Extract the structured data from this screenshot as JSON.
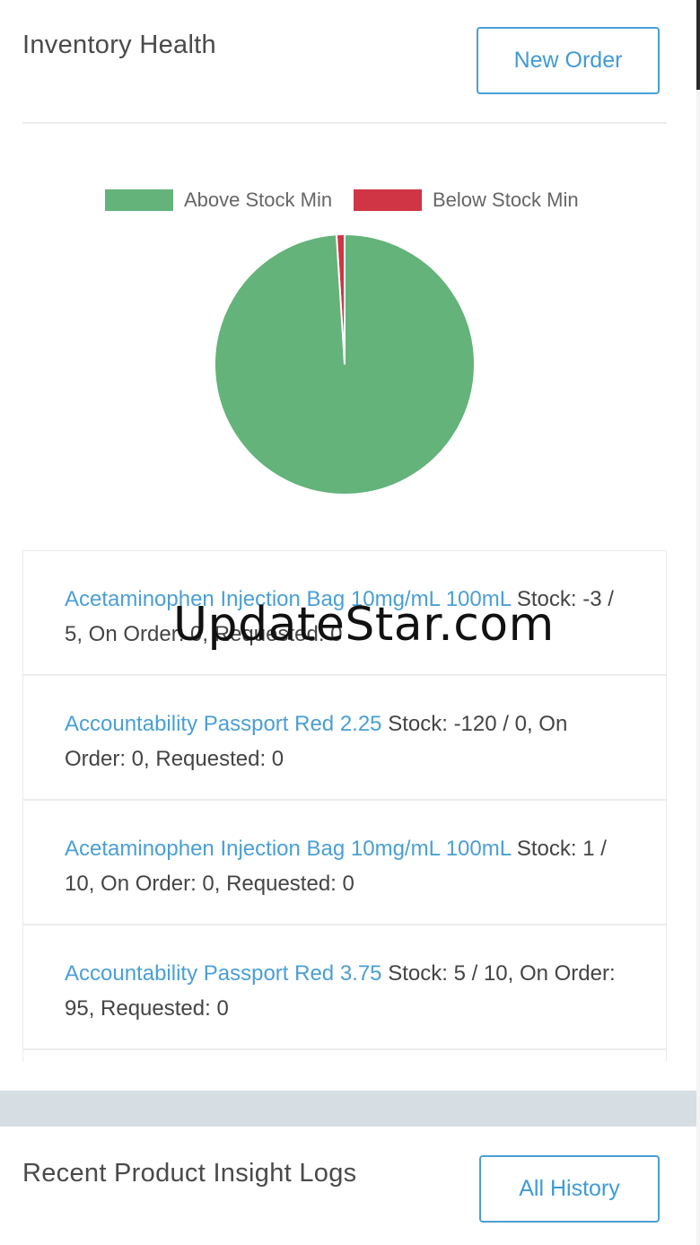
{
  "inventory": {
    "title": "Inventory Health",
    "new_order_label": "New Order"
  },
  "legend": [
    {
      "label": "Above Stock Min",
      "color": "#63b37a"
    },
    {
      "label": "Below Stock Min",
      "color": "#cf3544"
    }
  ],
  "chart_data": {
    "type": "pie",
    "slices": [
      {
        "name": "Above Stock Min",
        "value": 99,
        "color": "#63b37a"
      },
      {
        "name": "Below Stock Min",
        "value": 1,
        "color": "#cf3544"
      }
    ],
    "legend_position": "top"
  },
  "items": [
    {
      "name": "Acetaminophen Injection Bag 10mg/mL 100mL",
      "details": "Stock: -3 / 5, On Order: 0, Requested: 0"
    },
    {
      "name": "Accountability Passport Red 2.25",
      "details": "Stock: -120 / 0, On Order: 0, Requested: 0"
    },
    {
      "name": "Acetaminophen Injection Bag 10mg/mL 100mL",
      "details": "Stock: 1 / 10, On Order: 0, Requested: 0"
    },
    {
      "name": "Accountability Passport Red 3.75",
      "details": "Stock: 5 / 10, On Order: 95, Requested: 0"
    }
  ],
  "watermark": "UpdateStar.com",
  "logs": {
    "title": "Recent Product Insight Logs",
    "all_history_label": "All History"
  }
}
